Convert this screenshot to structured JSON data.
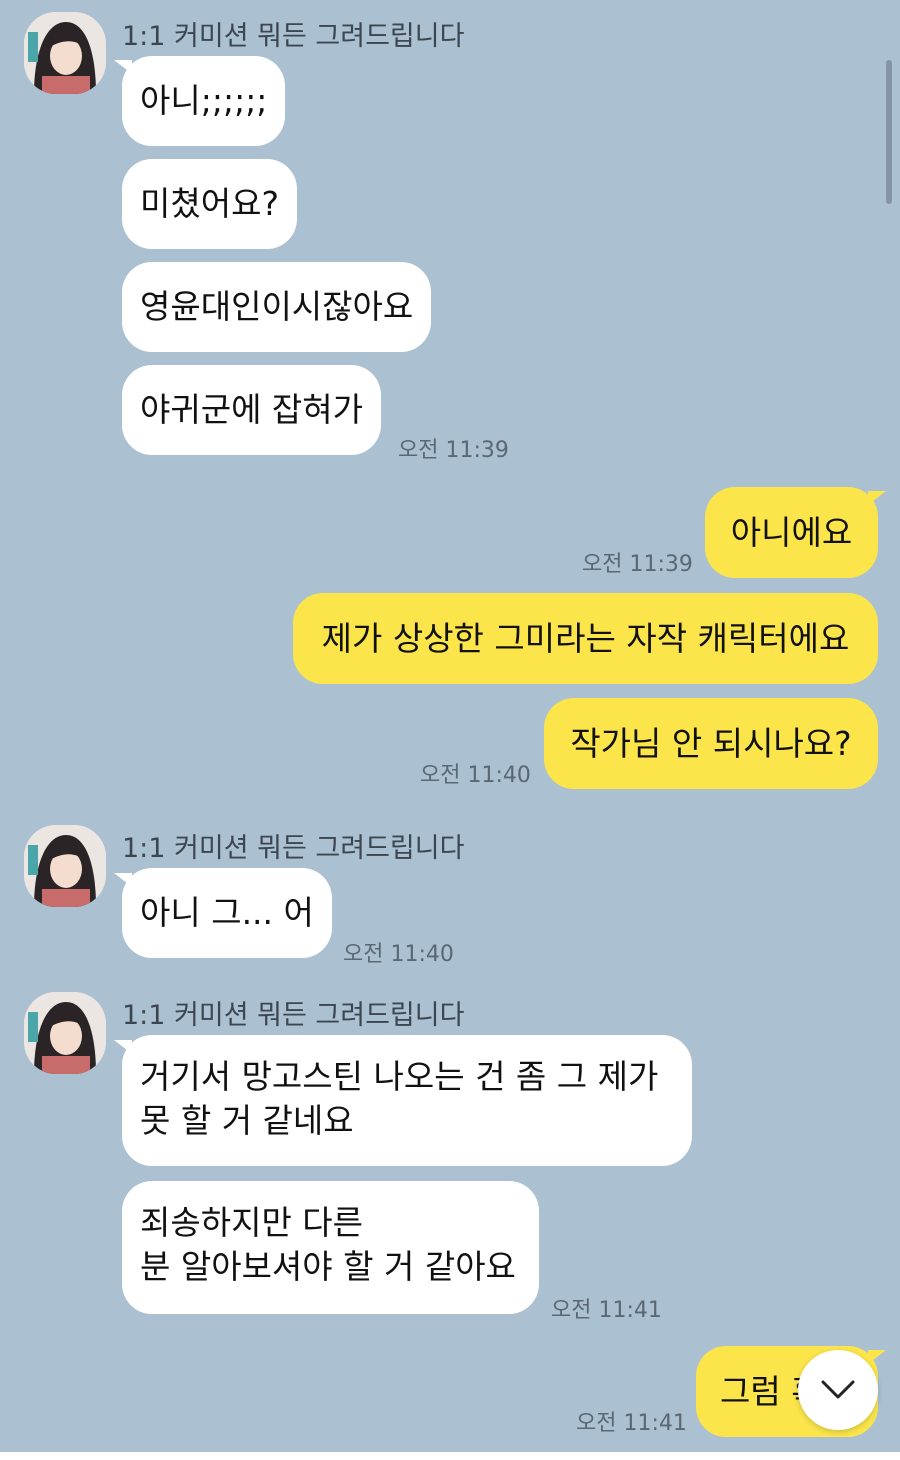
{
  "sender_name": "1:1 커미션 뭐든 그려드립니다",
  "groups": [
    {
      "type": "incoming",
      "messages": [
        "아니;;;;;;",
        "미쳤어요?",
        "영윤대인이시잖아요",
        "야귀군에 잡혀가"
      ],
      "time": "오전 11:39"
    },
    {
      "type": "outgoing",
      "messages": [
        "아니에요"
      ],
      "time": "오전 11:39"
    },
    {
      "type": "outgoing",
      "messages": [
        "제가 상상한 그미라는 자작 캐릭터에요",
        "작가님 안 되시나요?"
      ],
      "time": "오전 11:40"
    },
    {
      "type": "incoming",
      "messages": [
        "아니 그... 어"
      ],
      "time": "오전 11:40"
    },
    {
      "type": "incoming",
      "messages": [
        "거기서 망고스틴 나오는 건 좀 그 제가 못 할 거 같네요",
        "죄송하지만 다른\n분 알아보셔야 할 거 같아요"
      ],
      "time": "오전 11:41"
    },
    {
      "type": "outgoing",
      "messages": [
        "그럼 혹시"
      ],
      "time": "오전 11:41"
    }
  ],
  "icons": {
    "avatar": "profile-avatar",
    "scroll_down": "chevron-down-icon"
  },
  "colors": {
    "background": "#abc1d1",
    "incoming_bubble": "#ffffff",
    "outgoing_bubble": "#fbe54b"
  }
}
